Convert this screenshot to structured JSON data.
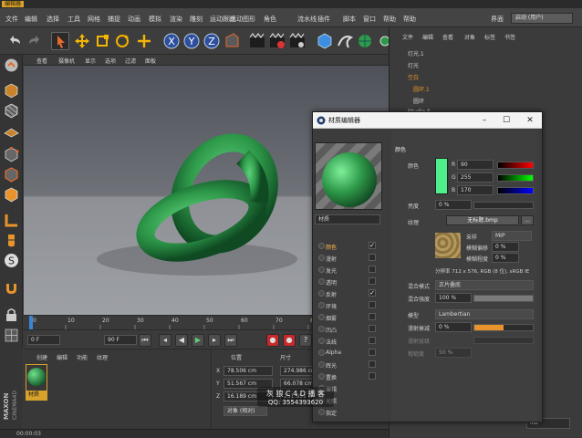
{
  "app": {
    "title_badge": "编辑器"
  },
  "menu": {
    "items": [
      "文件",
      "编辑",
      "选择",
      "工具",
      "网格",
      "捕捉",
      "动画",
      "模拟",
      "渲染",
      "雕刻",
      "运动跟踪",
      "运动图形",
      "角色",
      "流水线",
      "插件",
      "脚本",
      "窗口",
      "帮助"
    ],
    "layout_label": "界面",
    "layout_value": "启动 (用户)"
  },
  "viewport_menu": [
    "查看",
    "摄像机",
    "显示",
    "选项",
    "过滤",
    "面板"
  ],
  "timeline": {
    "ticks": [
      "0",
      "10",
      "20",
      "30",
      "40",
      "50",
      "60",
      "70",
      "80",
      "90"
    ],
    "start_field": "0 F",
    "end_field": "90 F"
  },
  "material_panel": {
    "menu": [
      "创建",
      "编辑",
      "功能",
      "纹理"
    ],
    "material_name": "材质"
  },
  "coords": {
    "headers": [
      "位置",
      "尺寸",
      "旋转"
    ],
    "rows": [
      {
        "axis": "X",
        "pos": "78.506 cm",
        "size": "274.986 cm"
      },
      {
        "axis": "Y",
        "pos": "51.567 cm",
        "size": "66.078 cm"
      },
      {
        "axis": "Z",
        "pos": "16.189 cm",
        "size": "251.951 cm"
      }
    ],
    "mode_select": "对象 (相对)",
    "size_select": "绝对尺寸",
    "apply_label": "应用"
  },
  "brand": {
    "line1": "MAXON",
    "line2": "CINEMA4D"
  },
  "status": {
    "time": "00:00:03"
  },
  "object_manager": {
    "menu": [
      "文件",
      "编辑",
      "查看",
      "对象",
      "标签",
      "书签"
    ],
    "objects": [
      "灯光.1",
      "灯光",
      "空白",
      "圆环.1",
      "圆环",
      "Studio S"
    ]
  },
  "material_editor": {
    "title": "材质编辑器",
    "material_name": "材质",
    "channels": [
      {
        "label": "颜色",
        "checked": true
      },
      {
        "label": "漫射",
        "checked": false
      },
      {
        "label": "发光",
        "checked": false
      },
      {
        "label": "透明",
        "checked": false
      },
      {
        "label": "反射",
        "checked": true
      },
      {
        "label": "环境",
        "checked": false
      },
      {
        "label": "烟雾",
        "checked": false
      },
      {
        "label": "凹凸",
        "checked": false
      },
      {
        "label": "法线",
        "checked": false
      },
      {
        "label": "Alpha",
        "checked": false
      },
      {
        "label": "辉光",
        "checked": false
      },
      {
        "label": "置换",
        "checked": false
      },
      {
        "label": "编辑",
        "checked": false
      },
      {
        "label": "光照",
        "checked": false
      },
      {
        "label": "指定",
        "checked": false
      }
    ],
    "section_title": "颜色",
    "color": {
      "label": "颜色",
      "swatch": "#4ff08c",
      "r_label": "R",
      "r": "90",
      "g_label": "G",
      "g": "255",
      "b_label": "B",
      "b": "170"
    },
    "brightness": {
      "label": "亮度",
      "value": "0 %",
      "fraction": 0
    },
    "texture": {
      "label": "纹理",
      "file": "无标题.bmp",
      "more": "..."
    },
    "sampling": {
      "label": "采样",
      "value": "MIP"
    },
    "blur_offset": {
      "label": "模糊偏移",
      "value": "0 %"
    },
    "blur_scale": {
      "label": "模糊程度",
      "value": "0 %"
    },
    "resolution": "分辨率 712 x 576, RGB (8 位), sRGB IE",
    "mix_mode": {
      "label": "混合模式",
      "value": "正片叠底"
    },
    "mix_strength": {
      "label": "混合强度",
      "value": "100 %",
      "fraction": 1
    },
    "model": {
      "label": "模型",
      "value": "Lambertian"
    },
    "diffuse_falloff": {
      "label": "漫射衰减",
      "value": "0 %"
    },
    "diffuse_level": {
      "label": "漫射层级"
    },
    "roughness": {
      "label": "粗糙度",
      "value": "50 %"
    }
  },
  "watermark": {
    "line1": "灰 狼 C 4 D 播 客",
    "line2": "QQ: 3554393620"
  },
  "bottom_right": {
    "sampling_label": "采样",
    "sampling_value": "MIP",
    "blur_label": "模糊偏移"
  },
  "colors": {
    "accent": "#d9a22a",
    "material_green": "#2e9a4a",
    "highlight": "#ff8a00"
  }
}
